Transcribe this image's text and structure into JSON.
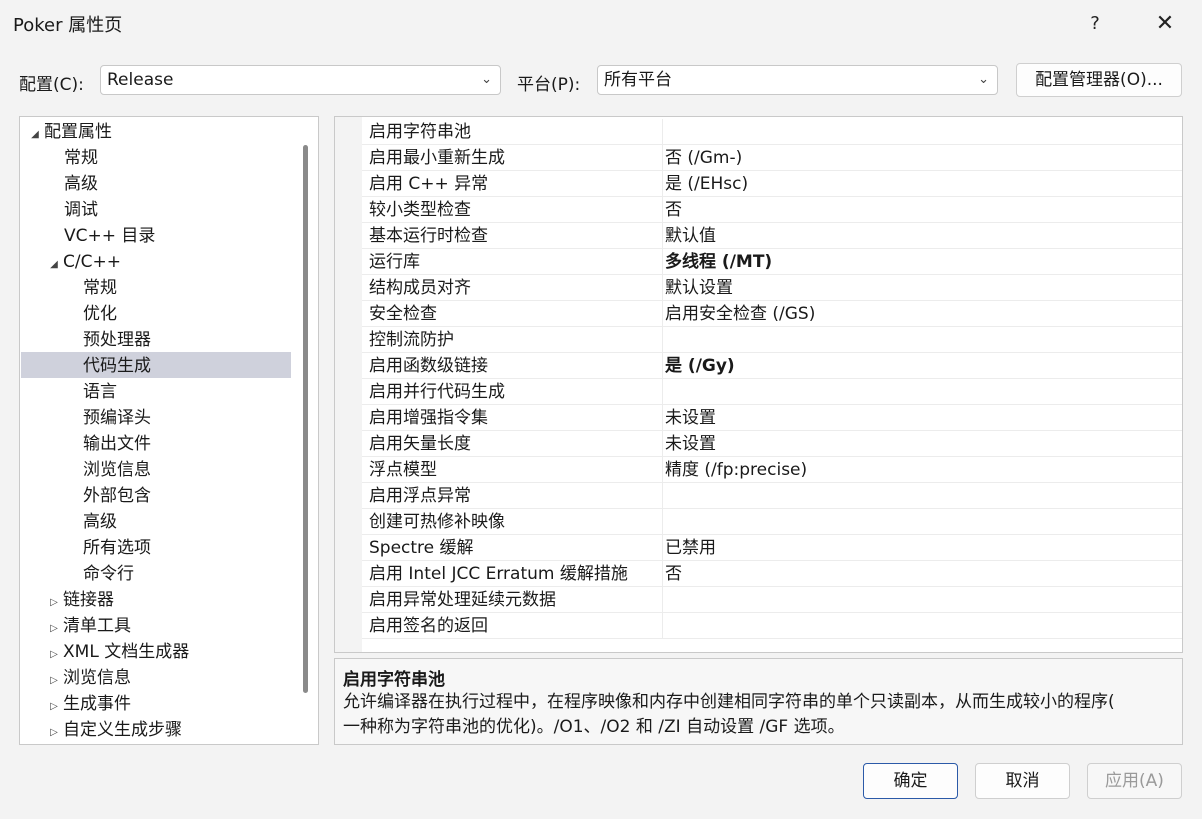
{
  "window": {
    "title": "Poker 属性页",
    "help": "?",
    "close": "✕"
  },
  "config": {
    "config_label": "配置(C):",
    "config_value": "Release",
    "platform_label": "平台(P):",
    "platform_value": "所有平台",
    "manager_button": "配置管理器(O)..."
  },
  "tree": {
    "items": [
      {
        "label": "配置属性",
        "arrow": "◢"
      },
      {
        "label": "常规"
      },
      {
        "label": "高级"
      },
      {
        "label": "调试"
      },
      {
        "label": "VC++ 目录"
      },
      {
        "label": "C/C++",
        "arrow": "◢"
      },
      {
        "label": "常规"
      },
      {
        "label": "优化"
      },
      {
        "label": "预处理器"
      },
      {
        "label": "代码生成"
      },
      {
        "label": "语言"
      },
      {
        "label": "预编译头"
      },
      {
        "label": "输出文件"
      },
      {
        "label": "浏览信息"
      },
      {
        "label": "外部包含"
      },
      {
        "label": "高级"
      },
      {
        "label": "所有选项"
      },
      {
        "label": "命令行"
      },
      {
        "label": "链接器",
        "arrow": "▷"
      },
      {
        "label": "清单工具",
        "arrow": "▷"
      },
      {
        "label": "XML 文档生成器",
        "arrow": "▷"
      },
      {
        "label": "浏览信息",
        "arrow": "▷"
      },
      {
        "label": "生成事件",
        "arrow": "▷"
      },
      {
        "label": "自定义生成步骤",
        "arrow": "▷"
      }
    ]
  },
  "properties": [
    {
      "name": "启用字符串池",
      "value": ""
    },
    {
      "name": "启用最小重新生成",
      "value": "否 (/Gm-)"
    },
    {
      "name": "启用 C++ 异常",
      "value": "是 (/EHsc)"
    },
    {
      "name": "较小类型检查",
      "value": "否"
    },
    {
      "name": "基本运行时检查",
      "value": "默认值"
    },
    {
      "name": "运行库",
      "value": "多线程 (/MT)"
    },
    {
      "name": "结构成员对齐",
      "value": "默认设置"
    },
    {
      "name": "安全检查",
      "value": "启用安全检查 (/GS)"
    },
    {
      "name": "控制流防护",
      "value": ""
    },
    {
      "name": "启用函数级链接",
      "value": "是 (/Gy)"
    },
    {
      "name": "启用并行代码生成",
      "value": ""
    },
    {
      "name": "启用增强指令集",
      "value": "未设置"
    },
    {
      "name": "启用矢量长度",
      "value": "未设置"
    },
    {
      "name": "浮点模型",
      "value": "精度 (/fp:precise)"
    },
    {
      "name": "启用浮点异常",
      "value": ""
    },
    {
      "name": "创建可热修补映像",
      "value": ""
    },
    {
      "name": "Spectre 缓解",
      "value": "已禁用"
    },
    {
      "name": "启用 Intel JCC Erratum 缓解措施",
      "value": "否"
    },
    {
      "name": "启用异常处理延续元数据",
      "value": ""
    },
    {
      "name": "启用签名的返回",
      "value": ""
    }
  ],
  "description": {
    "title": "启用字符串池",
    "line1": "允许编译器在执行过程中，在程序映像和内存中创建相同字符串的单个只读副本，从而生成较小的程序(",
    "line2": "一种称为字符串池的优化)。/O1、/O2 和 /ZI 自动设置 /GF 选项。"
  },
  "buttons": {
    "ok": "确定",
    "cancel": "取消",
    "apply": "应用(A)"
  }
}
